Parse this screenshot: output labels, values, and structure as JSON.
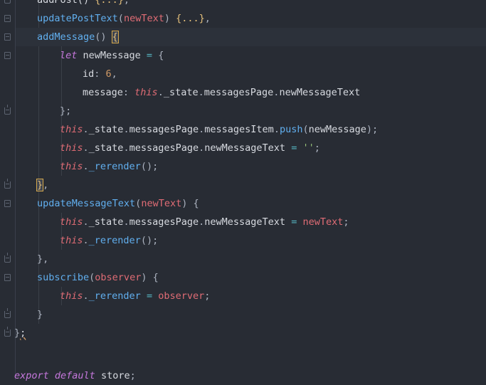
{
  "editor": {
    "language": "javascript",
    "lines": [
      [
        [
          "pln",
          "addPost() "
        ],
        [
          "brk",
          "{...}"
        ],
        [
          "punc",
          ","
        ]
      ],
      [
        [
          "fn",
          "updatePostText"
        ],
        [
          "punc",
          "("
        ],
        [
          "par",
          "newText"
        ],
        [
          "punc",
          ") "
        ],
        [
          "brk",
          "{...}"
        ],
        [
          "punc",
          ","
        ]
      ],
      [
        [
          "fn",
          "addMessage"
        ],
        [
          "punc",
          "() "
        ],
        [
          "bmatch",
          "{"
        ]
      ],
      [
        [
          "kw",
          "let "
        ],
        [
          "pln",
          "newMessage "
        ],
        [
          "op",
          "= "
        ],
        [
          "punc",
          "{"
        ]
      ],
      [
        [
          "pln",
          "id"
        ],
        [
          "punc",
          ": "
        ],
        [
          "num",
          "6"
        ],
        [
          "punc",
          ","
        ]
      ],
      [
        [
          "pln",
          "message"
        ],
        [
          "punc",
          ": "
        ],
        [
          "pro",
          "this"
        ],
        [
          "punc",
          "."
        ],
        [
          "pln",
          "_state"
        ],
        [
          "punc",
          "."
        ],
        [
          "pln",
          "messagesPage"
        ],
        [
          "punc",
          "."
        ],
        [
          "pln",
          "newMessageText"
        ]
      ],
      [
        [
          "punc",
          "};"
        ]
      ],
      [
        [
          "pro",
          "this"
        ],
        [
          "punc",
          "."
        ],
        [
          "pln",
          "_state"
        ],
        [
          "punc",
          "."
        ],
        [
          "pln",
          "messagesPage"
        ],
        [
          "punc",
          "."
        ],
        [
          "pln",
          "messagesItem"
        ],
        [
          "punc",
          "."
        ],
        [
          "fn",
          "push"
        ],
        [
          "punc",
          "("
        ],
        [
          "pln",
          "newMessage"
        ],
        [
          "punc",
          ");"
        ]
      ],
      [
        [
          "pro",
          "this"
        ],
        [
          "punc",
          "."
        ],
        [
          "pln",
          "_state"
        ],
        [
          "punc",
          "."
        ],
        [
          "pln",
          "messagesPage"
        ],
        [
          "punc",
          "."
        ],
        [
          "pln",
          "newMessageText "
        ],
        [
          "op",
          "= "
        ],
        [
          "str",
          "''"
        ],
        [
          "punc",
          ";"
        ]
      ],
      [
        [
          "pro",
          "this"
        ],
        [
          "punc",
          "."
        ],
        [
          "fn",
          "_rerender"
        ],
        [
          "punc",
          "();"
        ]
      ],
      [
        [
          "bmatch",
          "}"
        ],
        [
          "punc",
          ","
        ]
      ],
      [
        [
          "fn",
          "updateMessageText"
        ],
        [
          "punc",
          "("
        ],
        [
          "par",
          "newText"
        ],
        [
          "punc",
          ") {"
        ]
      ],
      [
        [
          "pro",
          "this"
        ],
        [
          "punc",
          "."
        ],
        [
          "pln",
          "_state"
        ],
        [
          "punc",
          "."
        ],
        [
          "pln",
          "messagesPage"
        ],
        [
          "punc",
          "."
        ],
        [
          "pln",
          "newMessageText "
        ],
        [
          "op",
          "= "
        ],
        [
          "par",
          "newText"
        ],
        [
          "punc",
          ";"
        ]
      ],
      [
        [
          "pro",
          "this"
        ],
        [
          "punc",
          "."
        ],
        [
          "fn",
          "_rerender"
        ],
        [
          "punc",
          "();"
        ]
      ],
      [
        [
          "punc",
          "},"
        ]
      ],
      [
        [
          "fn",
          "subscribe"
        ],
        [
          "punc",
          "("
        ],
        [
          "par",
          "observer"
        ],
        [
          "punc",
          ") {"
        ]
      ],
      [
        [
          "pro",
          "this"
        ],
        [
          "punc",
          "."
        ],
        [
          "fn",
          "_rerender "
        ],
        [
          "op",
          "= "
        ],
        [
          "par",
          "observer"
        ],
        [
          "punc",
          ";"
        ]
      ],
      [
        [
          "punc",
          "}"
        ]
      ],
      [
        [
          "punc",
          "}"
        ],
        [
          "squiggle",
          ";"
        ]
      ],
      [],
      [
        [
          "kw",
          "export "
        ],
        [
          "kw",
          "default "
        ],
        [
          "pln",
          "store"
        ],
        [
          "punc",
          ";"
        ]
      ]
    ]
  }
}
